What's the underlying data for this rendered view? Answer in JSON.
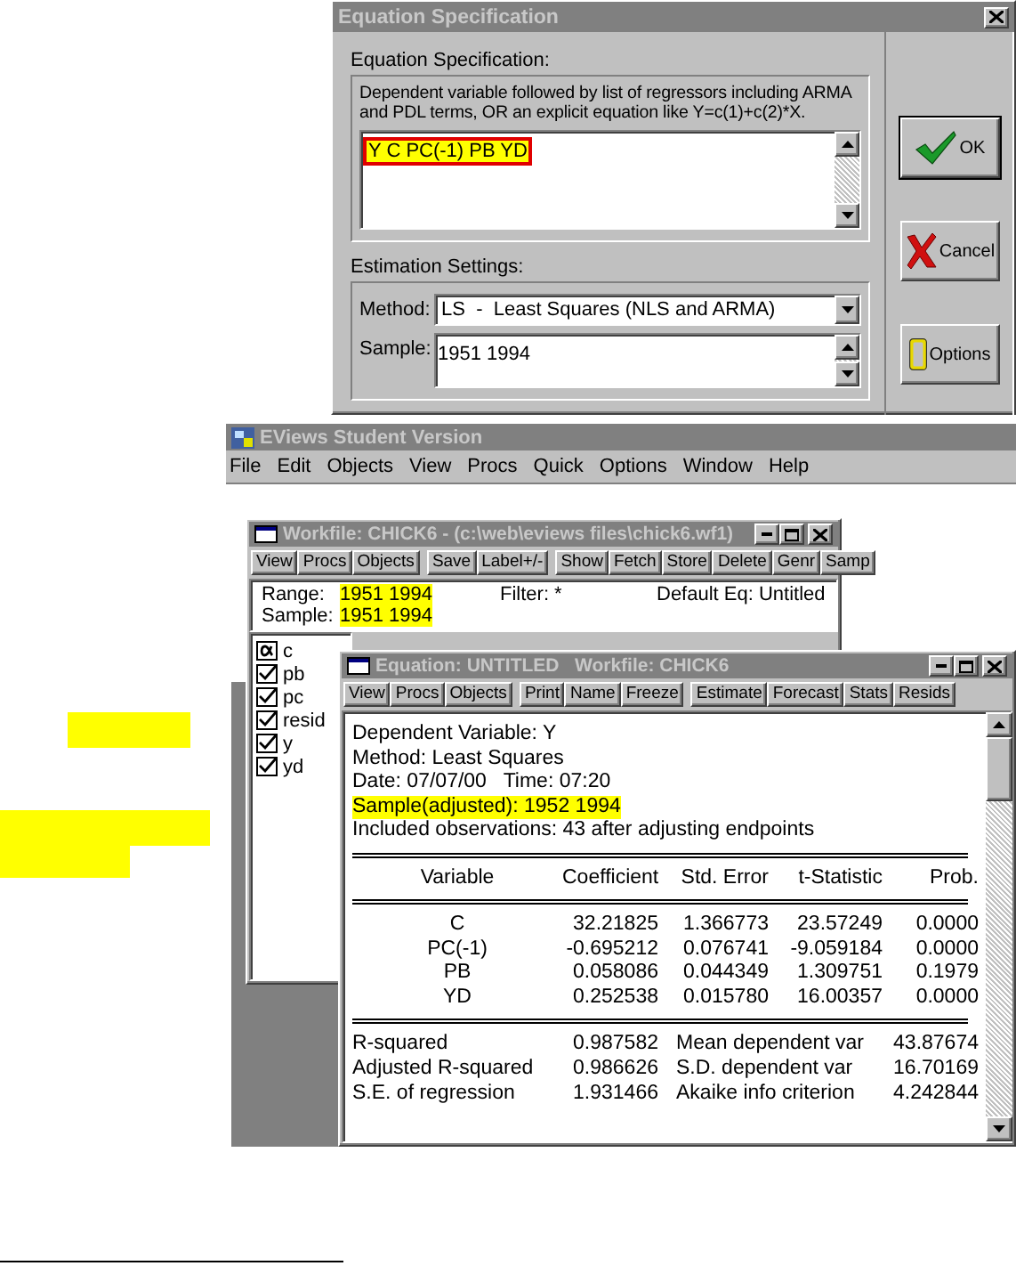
{
  "equation_dialog": {
    "title": "Equation Specification",
    "spec_group_label": "Equation Specification:",
    "instructions": "Dependent variable followed by list of regressors including ARMA and PDL terms, OR an explicit equation like Y=c(1)+c(2)*X.",
    "equation_text": "Y C PC(-1) PB YD",
    "settings_group_label": "Estimation Settings:",
    "method_label": "Method:",
    "method_value": "LS  -  Least Squares (NLS and ARMA)",
    "sample_label": "Sample:",
    "sample_value": "1951 1994",
    "buttons": [
      {
        "kind": "ok",
        "label": "OK"
      },
      {
        "kind": "cancel",
        "label": "Cancel"
      },
      {
        "kind": "options",
        "label": "Options"
      }
    ]
  },
  "main_window": {
    "title": "EViews Student Version",
    "menu": [
      "File",
      "Edit",
      "Objects",
      "View",
      "Procs",
      "Quick",
      "Options",
      "Window",
      "Help"
    ]
  },
  "workfile": {
    "title": "Workfile: CHICK6 - (c:\\web\\eviews files\\chick6.wf1)",
    "toolbar": [
      [
        "View",
        "Procs",
        "Objects"
      ],
      [
        "Save",
        "Label+/-"
      ],
      [
        "Show",
        "Fetch",
        "Store",
        "Delete",
        "Genr",
        "Samp"
      ]
    ],
    "range_label": "Range:",
    "range_value": "1951 1994",
    "filter": "Filter: *",
    "default_eq": "Default Eq: Untitled",
    "sample_label": "Sample:",
    "sample_value": "1951 1994",
    "objects": [
      {
        "kind": "coef",
        "name": "c"
      },
      {
        "kind": "series",
        "name": "pb"
      },
      {
        "kind": "series",
        "name": "pc"
      },
      {
        "kind": "series",
        "name": "resid"
      },
      {
        "kind": "series",
        "name": "y"
      },
      {
        "kind": "series",
        "name": "yd"
      }
    ]
  },
  "equation_window": {
    "title": "Equation: UNTITLED   Workfile: CHICK6",
    "toolbar": [
      [
        "View",
        "Procs",
        "Objects"
      ],
      [
        "Print",
        "Name",
        "Freeze"
      ],
      [
        "Estimate",
        "Forecast",
        "Stats",
        "Resids"
      ]
    ],
    "header_lines": [
      {
        "text": "Dependent Variable: Y",
        "highlighted": false
      },
      {
        "text": "Method: Least Squares",
        "highlighted": false
      },
      {
        "text": "Date: 07/07/00   Time: 07:20",
        "highlighted": false
      },
      {
        "text": "Sample(adjusted): 1952 1994",
        "highlighted": true
      },
      {
        "text": "Included observations: 43 after adjusting endpoints",
        "highlighted": false
      }
    ],
    "table": {
      "columns": [
        "Variable",
        "Coefficient",
        "Std. Error",
        "t-Statistic",
        "Prob."
      ],
      "rows": [
        [
          "C",
          "32.21825",
          "1.366773",
          "23.57249",
          "0.0000"
        ],
        [
          "PC(-1)",
          "-0.695212",
          "0.076741",
          "-9.059184",
          "0.0000"
        ],
        [
          "PB",
          "0.058086",
          "0.044349",
          "1.309751",
          "0.1979"
        ],
        [
          "YD",
          "0.252538",
          "0.015780",
          "16.00357",
          "0.0000"
        ]
      ]
    },
    "stats": [
      [
        "R-squared",
        "0.987582",
        "Mean dependent var",
        "43.87674"
      ],
      [
        "Adjusted R-squared",
        "0.986626",
        "S.D. dependent var",
        "16.70169"
      ],
      [
        "S.E. of regression",
        "1.931466",
        "Akaike info criterion",
        "4.242844"
      ]
    ]
  }
}
